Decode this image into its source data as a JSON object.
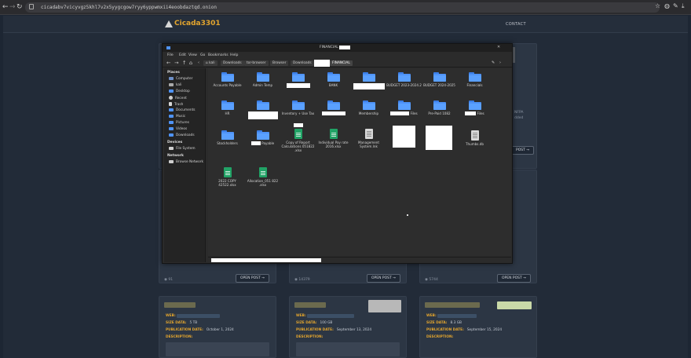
{
  "browser": {
    "url": "cicadabv7vicyvgz5khl7v2x5yygcgow7ryy6yppwmxii4eoobdaztqd.onion",
    "back_icon": "arrow-left-icon",
    "forward_icon": "arrow-right-icon",
    "reload_icon": "reload-icon"
  },
  "site": {
    "logo_text": "Cicada3301",
    "nav_contact": "CONTACT",
    "cards": [
      {
        "views": "91",
        "open_label": "OPEN POST →"
      },
      {
        "views": "14379",
        "open_label": "OPEN POST →"
      },
      {
        "views": "5744",
        "open_label": "OPEN POST →"
      }
    ],
    "side_open_label": "POST →",
    "side_text": "NFPA",
    "side_text2": "dded",
    "bottom_cards": [
      {
        "web": "WEB:",
        "size_label": "SIZE DATA:",
        "size": "5 TB",
        "date_label": "PUBLICATION DATE:",
        "date": "October 1, 2024",
        "desc_label": "DESCRIPTION:"
      },
      {
        "web": "WEB:",
        "size_label": "SIZE DATA:",
        "size": "100 GB",
        "date_label": "PUBLICATION DATE:",
        "date": "September 13, 2024",
        "desc_label": "DESCRIPTION:"
      },
      {
        "web": "WEB:",
        "size_label": "SIZE DATA:",
        "size": "8.3 GB",
        "date_label": "PUBLICATION DATE:",
        "date": "September 15, 2024",
        "desc_label": "DESCRIPTION:"
      }
    ]
  },
  "filemanager": {
    "title": "FINANCIAL -",
    "menu": [
      "File",
      "Edit",
      "View",
      "Go",
      "Bookmarks",
      "Help"
    ],
    "breadcrumbs": [
      "kali",
      "Downloads",
      "tor-browser",
      "Browser",
      "Downloads",
      "FINANCIAL"
    ],
    "sidebar": {
      "places_label": "Places",
      "places": [
        "Computer",
        "kali",
        "Desktop",
        "Recent",
        "Trash",
        "Documents",
        "Music",
        "Pictures",
        "Videos",
        "Downloads"
      ],
      "devices_label": "Devices",
      "devices": [
        "File System"
      ],
      "network_label": "Network",
      "network": [
        "Browse Network"
      ]
    },
    "items": [
      {
        "label": "Accounts Payable",
        "kind": "folder"
      },
      {
        "label": "Admin Temp",
        "kind": "folder"
      },
      {
        "label": "",
        "kind": "folder"
      },
      {
        "label": "BANK",
        "kind": "folder"
      },
      {
        "label": "",
        "kind": "folder"
      },
      {
        "label": "BUDGET 2023-2024.2",
        "kind": "folder"
      },
      {
        "label": "BUDGET 2024-2025",
        "kind": "folder"
      },
      {
        "label": "Financials",
        "kind": "folder"
      },
      {
        "label": "HR",
        "kind": "folder"
      },
      {
        "label": "",
        "kind": "folder"
      },
      {
        "label": "Inventory + Use Tax",
        "kind": "folder"
      },
      {
        "label": "",
        "kind": "folder"
      },
      {
        "label": "Membership",
        "kind": "folder"
      },
      {
        "label": "Files",
        "kind": "folder"
      },
      {
        "label": "Pre-Paid 1082",
        "kind": "folder"
      },
      {
        "label": "Files",
        "kind": "folder"
      },
      {
        "label": "Stockholders",
        "kind": "folder"
      },
      {
        "label": "Payable",
        "kind": "folder"
      },
      {
        "label": "Copy of Report Calculations 051822 .xlsx",
        "kind": "sheet"
      },
      {
        "label": "Individual Pay rate 2016.xlsx",
        "kind": "sheet"
      },
      {
        "label": "Management System.lnk",
        "kind": "doc"
      },
      {
        "label": "",
        "kind": "redacted"
      },
      {
        "label": "",
        "kind": "redacted"
      },
      {
        "label": "Thumbs.db",
        "kind": "doc"
      },
      {
        "label": "2022 COPY 42522.xlsx",
        "kind": "sheet"
      },
      {
        "label": "Allocation_051 822 .xlsx",
        "kind": "sheet"
      }
    ]
  }
}
